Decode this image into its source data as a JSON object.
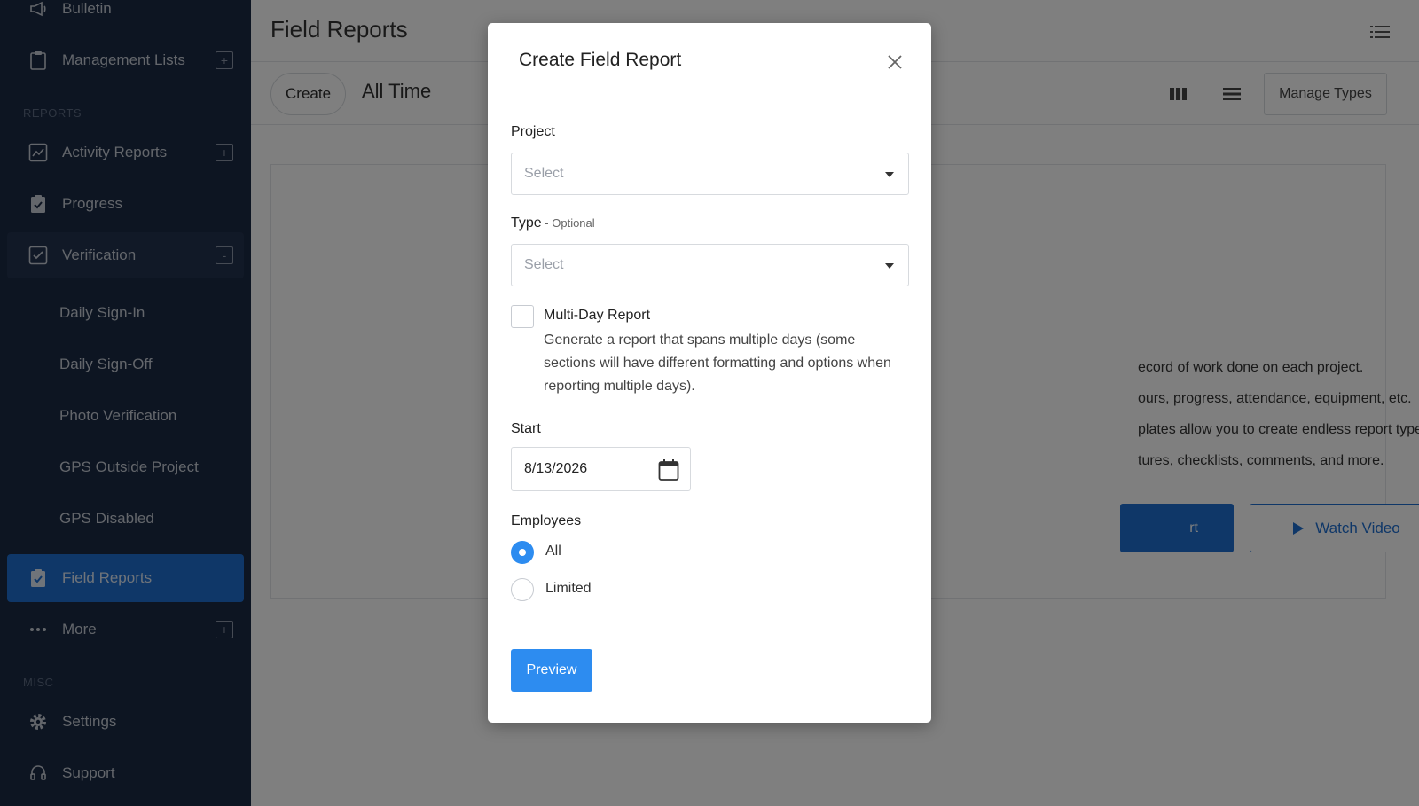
{
  "sidebar": {
    "items": [
      {
        "label": "Bulletin",
        "icon": "megaphone-icon"
      },
      {
        "label": "Management Lists",
        "icon": "clipboard-icon"
      },
      {
        "label": "Activity Reports",
        "icon": "chart-icon"
      },
      {
        "label": "Progress",
        "icon": "clipboard-check-icon"
      },
      {
        "label": "Verification",
        "icon": "check-square-icon"
      },
      {
        "label": "Field Reports",
        "icon": "clipboard-check-icon"
      },
      {
        "label": "More",
        "icon": "ellipsis-icon"
      },
      {
        "label": "Settings",
        "icon": "gear-icon"
      },
      {
        "label": "Support",
        "icon": "headset-icon"
      }
    ],
    "sections": {
      "reports": "REPORTS",
      "misc": "MISC"
    },
    "verification_sub": [
      "Daily Sign-In",
      "Daily Sign-Off",
      "Photo Verification",
      "GPS Outside Project",
      "GPS Disabled"
    ],
    "expand_symbol": "+",
    "collapse_symbol": "-"
  },
  "header": {
    "title": "Field Reports"
  },
  "toolbar": {
    "create_label": "Create",
    "range_label": "All Time",
    "manage_types_label": "Manage Types"
  },
  "content": {
    "lines": [
      "ecord of work done on each project.",
      "ours, progress, attendance, equipment, etc.",
      "plates allow you to create endless report types.",
      "tures, checklists, comments, and more."
    ],
    "primary_button_fragment": "rt",
    "watch_video_label": "Watch Video"
  },
  "modal": {
    "title": "Create Field Report",
    "project_label": "Project",
    "project_placeholder": "Select",
    "type_label": "Type",
    "type_optional": " - Optional",
    "type_placeholder": "Select",
    "multi_day_title": "Multi-Day Report",
    "multi_day_desc": "Generate a report that spans multiple days (some sections will have different formatting and options when reporting multiple days).",
    "start_label": "Start",
    "start_value": "8/13/2026",
    "employees_label": "Employees",
    "employees_options": [
      "All",
      "Limited"
    ],
    "employees_selected": "All",
    "preview_label": "Preview"
  },
  "colors": {
    "sidebar_bg": "#1b2a44",
    "accent": "#1f6fd1",
    "primary_button": "#2d8cf0"
  }
}
